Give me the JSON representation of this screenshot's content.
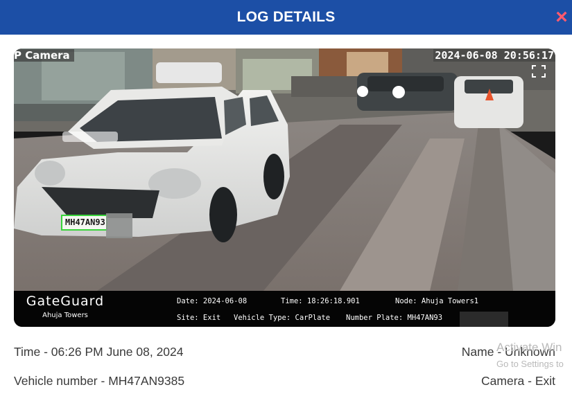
{
  "header": {
    "title": "LOG DETAILS",
    "close_icon": "×"
  },
  "colors": {
    "header_bg": "#1c4fa6",
    "close": "#ff5a6e",
    "plate_border": "#38d43a"
  },
  "camera": {
    "label": "P Camera",
    "timestamp": "2024-06-08 20:56:17",
    "plate_text": "MH47AN93",
    "info": {
      "brand": "GateGuard",
      "site_name": "Ahuja Towers",
      "date": "Date: 2024-06-08",
      "time": "Time: 18:26:18.901",
      "node": "Node: Ahuja Towers1",
      "site": "Site: Exit",
      "vehicle_type": "Vehicle Type: CarPlate",
      "number_plate": "Number Plate: MH47AN93"
    }
  },
  "details": {
    "time_label": "Time - ",
    "time_value": "06:26 PM June 08, 2024",
    "vehicle_label": "Vehicle number - ",
    "vehicle_value": "MH47AN9385",
    "name_label": "Name - ",
    "name_value": "Unknown",
    "camera_label": "Camera - ",
    "camera_value": "Exit"
  },
  "watermark": {
    "line1": "Activate Win",
    "line2": "Go to Settings to"
  }
}
